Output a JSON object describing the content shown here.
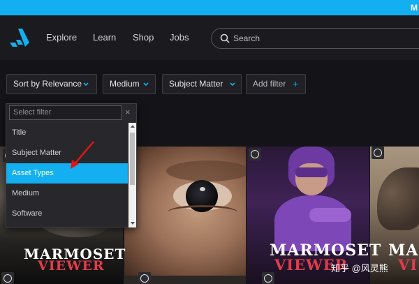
{
  "top_strip": {
    "text": "M",
    "color": "#13aff0"
  },
  "header": {
    "logo_icon": "artstation-logo",
    "nav": {
      "explore": "Explore",
      "learn": "Learn",
      "shop": "Shop",
      "jobs": "Jobs"
    },
    "search": {
      "placeholder": "Search",
      "icon": "search-icon"
    }
  },
  "filters": {
    "sort": "Sort by Relevance",
    "medium": "Medium",
    "subject": "Subject Matter",
    "add_filter": "Add filter",
    "add_icon": "+"
  },
  "dropdown": {
    "search_placeholder": "Select filter",
    "clear_icon": "×",
    "items": [
      "Title",
      "Subject Matter",
      "Asset Types",
      "Medium",
      "Software"
    ],
    "selected": "Asset Types",
    "highlight_color": "#13aff0"
  },
  "grid": {
    "brand_top": "MARMOSET",
    "brand_bottom": "VIEWER",
    "brand_partial_top": "MA",
    "brand_partial_bottom": "VI"
  },
  "watermark": "知乎 @风灵熊"
}
